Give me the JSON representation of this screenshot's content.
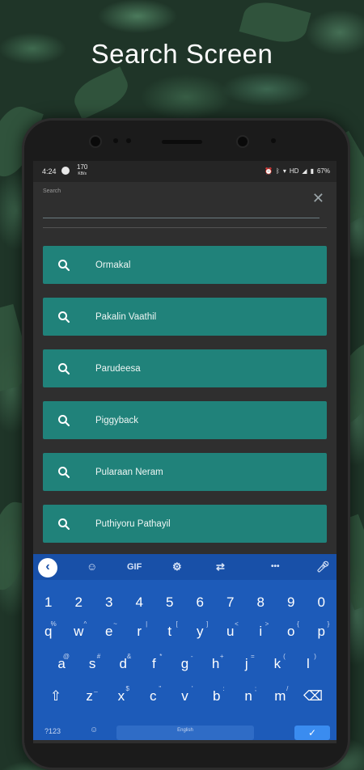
{
  "headline": "Search Screen",
  "status_bar": {
    "time": "4:24",
    "net_speed": "170",
    "net_unit": "KB/s",
    "signal": "HD",
    "battery": "67%"
  },
  "search": {
    "label": "Search",
    "value": "",
    "placeholder": ""
  },
  "results": [
    {
      "label": "Ormakal"
    },
    {
      "label": "Pakalin Vaathil"
    },
    {
      "label": "Parudeesa"
    },
    {
      "label": "Piggyback"
    },
    {
      "label": "Pularaan Neram"
    },
    {
      "label": "Puthiyoru Pathayil"
    }
  ],
  "keyboard": {
    "toolbar": {
      "gif": "GIF",
      "more": "•••"
    },
    "numbers": [
      "1",
      "2",
      "3",
      "4",
      "5",
      "6",
      "7",
      "8",
      "9",
      "0"
    ],
    "row1": [
      {
        "k": "q",
        "s": "%"
      },
      {
        "k": "w",
        "s": "^"
      },
      {
        "k": "e",
        "s": "~"
      },
      {
        "k": "r",
        "s": "|"
      },
      {
        "k": "t",
        "s": "["
      },
      {
        "k": "y",
        "s": "]"
      },
      {
        "k": "u",
        "s": "<"
      },
      {
        "k": "i",
        "s": ">"
      },
      {
        "k": "o",
        "s": "{"
      },
      {
        "k": "p",
        "s": "}"
      }
    ],
    "row2": [
      {
        "k": "a",
        "s": "@"
      },
      {
        "k": "s",
        "s": "#"
      },
      {
        "k": "d",
        "s": "&"
      },
      {
        "k": "f",
        "s": "*"
      },
      {
        "k": "g",
        "s": "-"
      },
      {
        "k": "h",
        "s": "+"
      },
      {
        "k": "j",
        "s": "="
      },
      {
        "k": "k",
        "s": "("
      },
      {
        "k": "l",
        "s": ")"
      }
    ],
    "row3": [
      {
        "k": "z",
        "s": "_"
      },
      {
        "k": "x",
        "s": "$"
      },
      {
        "k": "c",
        "s": "\""
      },
      {
        "k": "v",
        "s": "'"
      },
      {
        "k": "b",
        "s": ":"
      },
      {
        "k": "n",
        "s": ";"
      },
      {
        "k": "m",
        "s": "/"
      }
    ],
    "symbols_key": "?123",
    "space_label": "English"
  },
  "colors": {
    "accent": "#20827a",
    "keyboard": "#1d5bb9",
    "screen_bg": "#2f2f2f"
  }
}
